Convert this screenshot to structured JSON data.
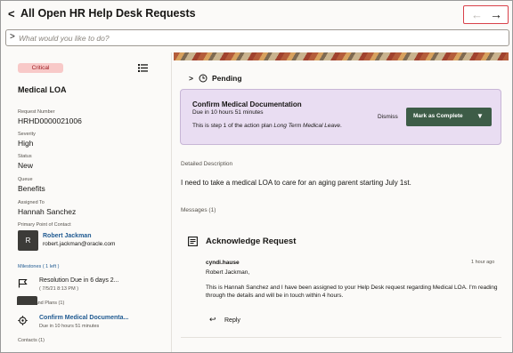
{
  "header": {
    "back_glyph": "<",
    "title": "All Open HR Help Desk Requests",
    "prev_glyph": "←",
    "next_glyph": "→"
  },
  "search": {
    "chevron": ">",
    "placeholder": "What would you like to do?"
  },
  "request": {
    "severity_badge": "Critical",
    "title": "Medical LOA",
    "fields": {
      "request_number_label": "Request Number",
      "request_number": "HRHD0000021006",
      "severity_label": "Severity",
      "severity": "High",
      "status_label": "Status",
      "status": "New",
      "queue_label": "Queue",
      "queue": "Benefits",
      "assigned_label": "Assigned To",
      "assigned": "Hannah Sanchez",
      "contact_label": "Primary Point of Contact"
    },
    "contact": {
      "initial": "R",
      "name": "Robert Jackman",
      "email": "robert.jackman@oracle.com"
    },
    "milestones_label": "Milestones ( 1 left )",
    "milestone": {
      "title": "Resolution Due in 6 days 2...",
      "date": "( 7/5/21 8:13 PM )"
    },
    "actions_label": "Actions and Plans (1)",
    "action": {
      "title": "Confirm Medical Documenta...",
      "due": "Due in 10 hours 51 minutes"
    },
    "contacts_label": "Contacts (1)"
  },
  "detail": {
    "status_chevron": ">",
    "status_label": "Pending",
    "task": {
      "title": "Confirm Medical Documentation",
      "due": "Due in 10 hours 51 minutes",
      "desc_prefix": "This is step 1 of the action plan ",
      "plan_name": "Long Term Medical Leave",
      "desc_suffix": ".",
      "dismiss_label": "Dismiss",
      "complete_label": "Mark as Complete",
      "complete_caret": "▼"
    },
    "description_label": "Detailed Description",
    "description": "I need to take a medical LOA to care for an aging parent starting July 1st.",
    "messages_label": "Messages (1)",
    "message": {
      "title": "Acknowledge Request",
      "author": "cyndi.hause",
      "time": "1 hour ago",
      "greeting": "Robert Jackman,",
      "body": "This is Hannah Sanchez and I have been assigned to your Help Desk request regarding Medical LOA. I'm reading through the details and will be in touch within 4 hours.",
      "reply_label": "Reply",
      "reply_glyph": "↩"
    }
  },
  "icons": {
    "list": "list-icon",
    "flag": "flag-icon",
    "gear": "gear-icon",
    "clock": "clock-icon",
    "message": "message-icon",
    "reply": "reply-icon"
  },
  "colors": {
    "accent_link": "#1f5a91",
    "badge_bg": "#f8c9c8",
    "task_bg": "#e9ddf2",
    "primary_button": "#3d5c47",
    "nav_highlight": "#d9414a"
  }
}
